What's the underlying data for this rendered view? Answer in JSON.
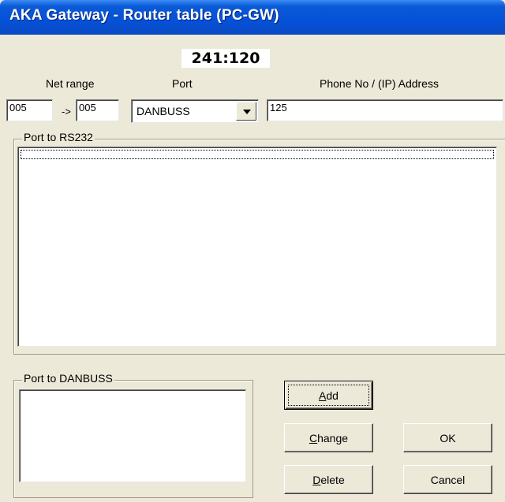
{
  "window": {
    "title": "AKA Gateway - Router table  (PC-GW)"
  },
  "address": "241:120",
  "labels": {
    "net_range": "Net range",
    "port": "Port",
    "phone": "Phone No / (IP) Address",
    "arrow": "->"
  },
  "fields": {
    "net_from": "005",
    "net_to": "005",
    "port_selected": "DANBUSS",
    "phone_address": "125"
  },
  "groups": {
    "rs232": {
      "label": "Port to RS232",
      "items": []
    },
    "danbuss": {
      "label": "Port to DANBUSS",
      "items": []
    }
  },
  "buttons": {
    "add": {
      "accel": "A",
      "rest": "dd"
    },
    "change": {
      "accel": "C",
      "rest": "hange"
    },
    "delete": {
      "accel": "D",
      "rest": "elete"
    },
    "ok": "OK",
    "cancel": "Cancel"
  }
}
